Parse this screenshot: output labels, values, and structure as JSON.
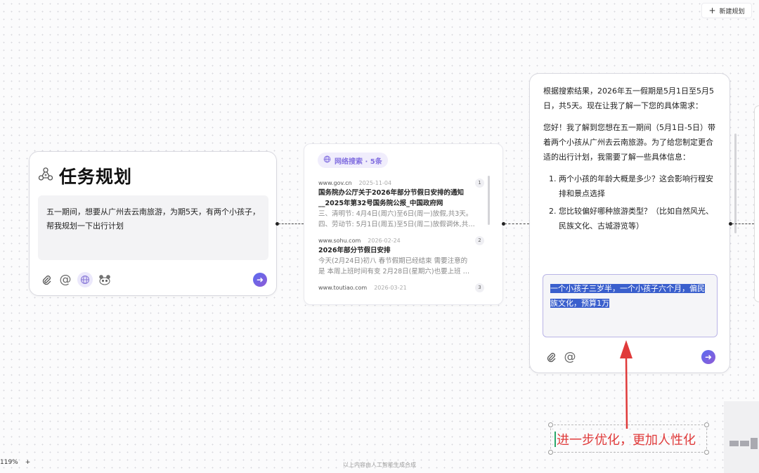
{
  "toolbar": {
    "new_plan_label": "新建规划",
    "new_plan_icon": "plus-icon"
  },
  "task_card": {
    "title": "任务规划",
    "icon": "plan-nodes-icon",
    "prompt": "五一期间，想要从广州去云南旅游，为期5天，有两个小孩子，帮我规划一下出行计划",
    "tool_icons": [
      "paperclip-icon",
      "at-icon",
      "globe-icon",
      "panda-icon"
    ],
    "send_icon": "arrow-right-icon"
  },
  "search_card": {
    "label": "网络搜索 · 5条",
    "icon": "globe-icon",
    "results": [
      {
        "num": "1",
        "source": "www.gov.cn",
        "date": "2025-11-04",
        "title": "国务院办公厅关于2026年部分节假日安排的通知__2025年第32号国务院公报_中国政府网",
        "snippet1": "三、清明节: 4月4日(周六)至6日(周一)放假,共3天。",
        "snippet2": "四、劳动节: 5月1日(周五)至5日(周二)放假调休,共…"
      },
      {
        "num": "2",
        "source": "www.sohu.com",
        "date": "2026-02-24",
        "title": "2026年部分节假日安排",
        "snippet1": "今天(2月24日)初八 春节假期已经结束 需要注意的",
        "snippet2": "是 本周上班时间有变 2月28日(星期六)也要上班 …"
      },
      {
        "num": "3",
        "source": "www.toutiao.com",
        "date": "2026-03-21"
      }
    ]
  },
  "chat_card": {
    "para1": "根据搜索结果，2026年五一假期是5月1日至5月5日，共5天。现在让我了解一下您的具体需求：",
    "para2": "您好！我了解到您想在五一期间（5月1日-5日）带着两个小孩从广州去云南旅游。为了给您制定更合适的出行计划，我需要了解一些具体信息：",
    "questions": [
      "两个小孩的年龄大概是多少？这会影响行程安排和景点选择",
      "您比较偏好哪种旅游类型？（比如自然风光、民族文化、古城游览等）"
    ],
    "reply": "一个小孩子三岁半，一个小孩子六个月，偏民族文化，预算1万",
    "tool_icons": [
      "paperclip-icon",
      "at-icon"
    ],
    "send_icon": "arrow-right-icon"
  },
  "annotation": {
    "text": "进一步优化，更加人性化",
    "color": "#e03a3a"
  },
  "status": {
    "zoom": "119%",
    "zoom_plus": "+",
    "footer_note": "以上内容由人工智能生成合成"
  }
}
